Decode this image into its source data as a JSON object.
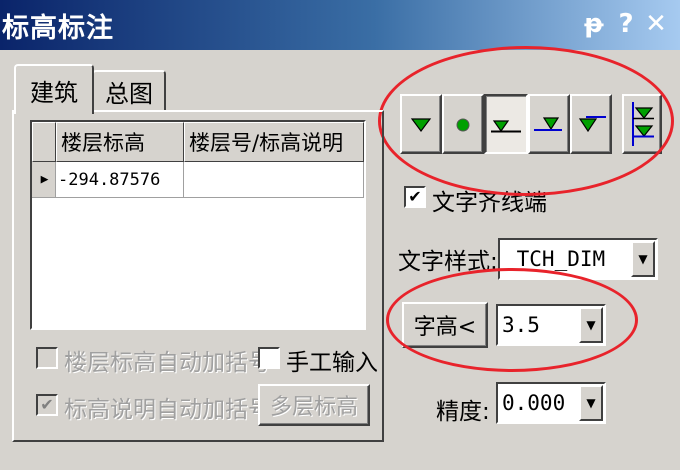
{
  "window": {
    "title": "标高标注",
    "pin_glyph": "ᵽ",
    "help_glyph": "?",
    "close_glyph": "✕"
  },
  "tabs": [
    {
      "label": "建筑",
      "active": true
    },
    {
      "label": "总图",
      "active": false
    }
  ],
  "table": {
    "columns": [
      "楼层标高",
      "楼层号/标高说明"
    ],
    "rows": [
      {
        "indicator": "▶",
        "elevation": "-294.87576",
        "desc": ""
      }
    ]
  },
  "options": {
    "auto_bracket_floor": {
      "label": "楼层标高自动加括号",
      "checked": false,
      "enabled": false
    },
    "manual_input": {
      "label": "手工输入",
      "checked": false,
      "enabled": true
    },
    "auto_bracket_desc": {
      "label": "标高说明自动加括号",
      "checked": true,
      "enabled": false
    },
    "multi_level_button": "多层标高"
  },
  "style_buttons": [
    {
      "name": "filled-triangle",
      "selected": false
    },
    {
      "name": "dot",
      "selected": false
    },
    {
      "name": "triangle-underline",
      "selected": true
    },
    {
      "name": "outline-triangle",
      "selected": false
    },
    {
      "name": "triangle-overline",
      "selected": false
    },
    {
      "name": "stacked-triangles",
      "selected": false
    }
  ],
  "text_align": {
    "label": "文字齐线端",
    "checked": true
  },
  "text_style": {
    "label": "文字样式:",
    "value": "_TCH_DIM"
  },
  "text_height": {
    "button_label": "字高<",
    "value": "3.5"
  },
  "precision": {
    "label": "精度:",
    "value": "0.000"
  },
  "colors": {
    "marker_fill": "#00a000",
    "marker_line": "#0000d0",
    "highlight_ring": "#e8232b"
  },
  "icons": {
    "check": "✔",
    "dropdown": "▼"
  }
}
